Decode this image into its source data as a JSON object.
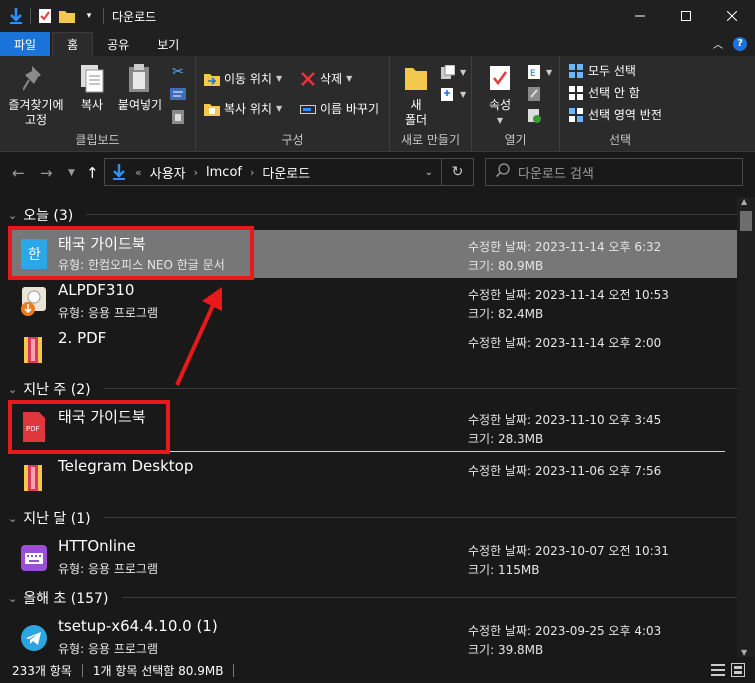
{
  "window": {
    "title": "다운로드"
  },
  "ribbon_tabs": [
    {
      "label": "파일"
    },
    {
      "label": "홈"
    },
    {
      "label": "공유"
    },
    {
      "label": "보기"
    }
  ],
  "ribbon": {
    "clipboard": {
      "pin_label_1": "즐겨찾기에",
      "pin_label_2": "고정",
      "copy_label": "복사",
      "paste_label": "붙여넣기",
      "group_label": "클립보드"
    },
    "organize": {
      "move_to": "이동 위치",
      "copy_to": "복사 위치",
      "delete": "삭제",
      "rename": "이름 바꾸기",
      "group_label": "구성"
    },
    "new": {
      "new_folder_1": "새",
      "new_folder_2": "폴더",
      "group_label": "새로 만들기"
    },
    "open": {
      "properties": "속성",
      "group_label": "열기"
    },
    "select": {
      "select_all": "모두 선택",
      "select_none": "선택 안 함",
      "invert": "선택 영역 반전",
      "group_label": "선택"
    }
  },
  "address": {
    "prefix": "«",
    "crumbs": [
      "사용자",
      "lmcof",
      "다운로드"
    ]
  },
  "search": {
    "placeholder": "다운로드 검색"
  },
  "groups": [
    {
      "label": "오늘 (3)"
    },
    {
      "label": "지난 주 (2)"
    },
    {
      "label": "지난 달 (1)"
    },
    {
      "label": "올해 초 (157)"
    }
  ],
  "files": [
    {
      "name": "태국 가이드북",
      "type": "유형: 한컴오피스 NEO 한글 문서",
      "modified": "수정한 날짜: 2023-11-14 오후 6:32",
      "size": "크기: 80.9MB",
      "icon": "hwp-icon"
    },
    {
      "name": "ALPDF310",
      "type": "유형: 응용 프로그램",
      "modified": "수정한 날짜: 2023-11-14 오전 10:53",
      "size": "크기: 82.4MB",
      "icon": "alpdf-installer-icon"
    },
    {
      "name": "2. PDF",
      "type": "",
      "modified": "수정한 날짜: 2023-11-14 오후 2:00",
      "size": "",
      "icon": "archive-folder-icon"
    },
    {
      "name": "태국 가이드북",
      "type": "",
      "modified": "수정한 날짜: 2023-11-10 오후 3:45",
      "size": "크기: 28.3MB",
      "icon": "pdf-icon"
    },
    {
      "name": "Telegram Desktop",
      "type": "",
      "modified": "수정한 날짜: 2023-11-06 오후 7:56",
      "size": "",
      "icon": "archive-folder-icon"
    },
    {
      "name": "HTTOnline",
      "type": "유형: 응용 프로그램",
      "modified": "수정한 날짜: 2023-10-07 오전 10:31",
      "size": "크기: 115MB",
      "icon": "keyboard-app-icon"
    },
    {
      "name": "tsetup-x64.4.10.0 (1)",
      "type": "유형: 응용 프로그램",
      "modified": "수정한 날짜: 2023-09-25 오후 4:03",
      "size": "크기: 39.8MB",
      "icon": "telegram-icon"
    }
  ],
  "status": {
    "count": "233개 항목",
    "selected": "1개 항목 선택함 80.9MB"
  },
  "colors": {
    "accent": "#1a73d9",
    "highlight": "#e8191b",
    "selected_row": "#777777",
    "background": "#191919"
  }
}
